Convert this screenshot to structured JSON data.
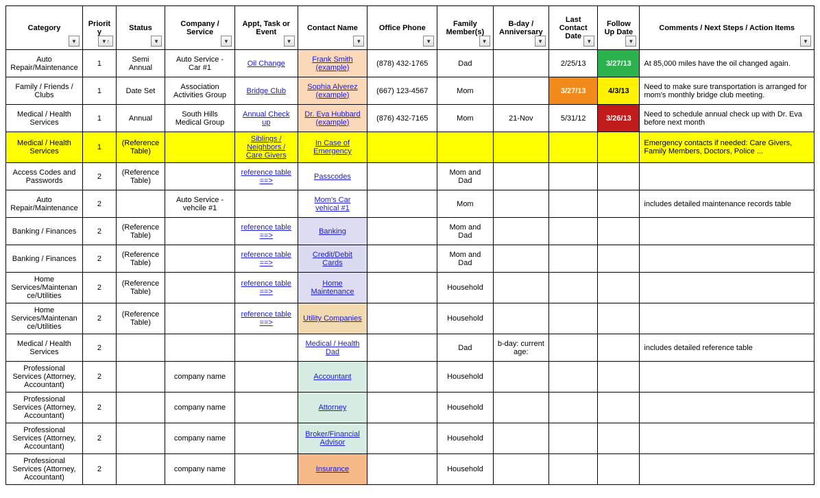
{
  "headers": {
    "category": "Category",
    "priority": "Priority",
    "status": "Status",
    "company": "Company / Service",
    "appt": "Appt, Task or Event",
    "contact": "Contact Name",
    "phone": "Office Phone",
    "family": "Family Member(s)",
    "bday": "B-day / Anniversary",
    "last": "Last Contact Date",
    "follow": "Follow Up Date",
    "comments": "Comments / Next Steps / Action Items"
  },
  "rows": [
    {
      "category": "Auto Repair/Maintenance",
      "priority": "1",
      "status": "Semi Annual",
      "company": "Auto Service - Car #1",
      "appt": "Oil Change",
      "contact": "Frank Smith (example)",
      "phone": "(878) 432-1765",
      "family": "Dad",
      "bday": "",
      "last": "2/25/13",
      "follow": "3/27/13",
      "comments": "At 85,000 miles have the oil changed again."
    },
    {
      "category": "Family / Friends / Clubs",
      "priority": "1",
      "status": "Date Set",
      "company": "Association Activities Group",
      "appt": "Bridge Club",
      "contact": "Sophia Alverez (example)",
      "phone": "(667) 123-4567",
      "family": "Mom",
      "bday": "",
      "last": "3/27/13",
      "follow": "4/3/13",
      "comments": "Need to make sure transportation is arranged for mom's monthly bridge club meeting."
    },
    {
      "category": "Medical / Health Services",
      "priority": "1",
      "status": "Annual",
      "company": "South Hills Medical Group",
      "appt": "Annual Check up",
      "contact": "Dr. Eva Hubbard (example)",
      "phone": "(876) 432-7165",
      "family": "Mom",
      "bday": "21-Nov",
      "last": "5/31/12",
      "follow": "3/26/13",
      "comments": "Need to schedule annual check up with Dr. Eva before next month"
    },
    {
      "category": "Medical / Health Services",
      "priority": "1",
      "status": "(Reference Table)",
      "company": "",
      "appt": "Siblings / Neighbors / Care Givers",
      "contact": "In Case of Emergency",
      "phone": "",
      "family": "",
      "bday": "",
      "last": "",
      "follow": "",
      "comments": "Emergency contacts if needed: Care Givers, Family Members, Doctors, Police ..."
    },
    {
      "category": "Access Codes and Passwords",
      "priority": "2",
      "status": "(Reference Table)",
      "company": "",
      "appt": "reference table ==>",
      "contact": "Passcodes",
      "phone": "",
      "family": "Mom and Dad",
      "bday": "",
      "last": "",
      "follow": "",
      "comments": ""
    },
    {
      "category": "Auto Repair/Maintenance",
      "priority": "2",
      "status": "",
      "company": "Auto Service - vehcile #1",
      "appt": "",
      "contact": "Mom's Car vehical #1",
      "phone": "",
      "family": "Mom",
      "bday": "",
      "last": "",
      "follow": "",
      "comments": "includes detailed maintenance records table"
    },
    {
      "category": "Banking / Finances",
      "priority": "2",
      "status": "(Reference Table)",
      "company": "",
      "appt": "reference table ==>",
      "contact": "Banking",
      "phone": "",
      "family": "Mom and Dad",
      "bday": "",
      "last": "",
      "follow": "",
      "comments": ""
    },
    {
      "category": "Banking / Finances",
      "priority": "2",
      "status": "(Reference Table)",
      "company": "",
      "appt": "reference table ==>",
      "contact": "Credit/Debit Cards",
      "phone": "",
      "family": "Mom and Dad",
      "bday": "",
      "last": "",
      "follow": "",
      "comments": ""
    },
    {
      "category": "Home Services/Maintenance/Utilities",
      "priority": "2",
      "status": "(Reference Table)",
      "company": "",
      "appt": "reference table ==>",
      "contact": "Home Maintenance",
      "phone": "",
      "family": "Household",
      "bday": "",
      "last": "",
      "follow": "",
      "comments": ""
    },
    {
      "category": "Home Services/Maintenance/Utilities",
      "priority": "2",
      "status": "(Reference Table)",
      "company": "",
      "appt": "reference table ==>",
      "contact": "Utility Companies",
      "phone": "",
      "family": "Household",
      "bday": "",
      "last": "",
      "follow": "",
      "comments": ""
    },
    {
      "category": "Medical / Health Services",
      "priority": "2",
      "status": "",
      "company": "",
      "appt": "",
      "contact": "Medical / Health Dad",
      "phone": "",
      "family": "Dad",
      "bday": "b-day:   current age:",
      "last": "",
      "follow": "",
      "comments": "includes detailed reference table"
    },
    {
      "category": "Professional Services (Attorney, Accountant)",
      "priority": "2",
      "status": "",
      "company": "company name",
      "appt": "",
      "contact": "Accountant",
      "phone": "",
      "family": "Household",
      "bday": "",
      "last": "",
      "follow": "",
      "comments": ""
    },
    {
      "category": "Professional Services (Attorney, Accountant)",
      "priority": "2",
      "status": "",
      "company": "company name",
      "appt": "",
      "contact": "Attorney",
      "phone": "",
      "family": "Household",
      "bday": "",
      "last": "",
      "follow": "",
      "comments": ""
    },
    {
      "category": "Professional Services (Attorney, Accountant)",
      "priority": "2",
      "status": "",
      "company": "company name",
      "appt": "",
      "contact": "Broker/Financial Advisor",
      "phone": "",
      "family": "Household",
      "bday": "",
      "last": "",
      "follow": "",
      "comments": ""
    },
    {
      "category": "Professional Services (Attorney, Accountant)",
      "priority": "2",
      "status": "",
      "company": "company name",
      "appt": "",
      "contact": "Insurance",
      "phone": "",
      "family": "Household",
      "bday": "",
      "last": "",
      "follow": "",
      "comments": ""
    }
  ]
}
